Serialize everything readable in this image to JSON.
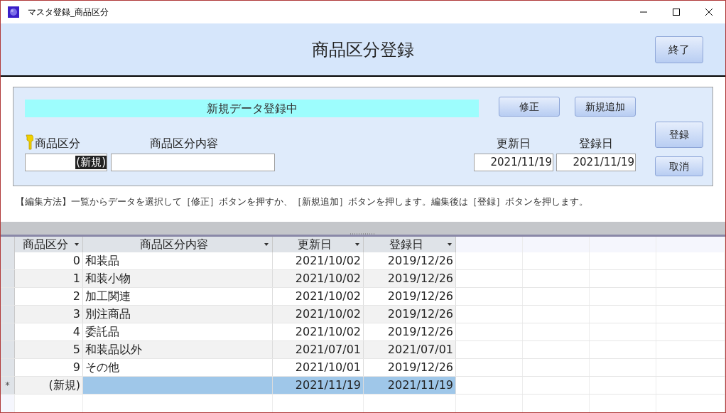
{
  "window": {
    "title": "マスタ登録_商品区分"
  },
  "header": {
    "title": "商品区分登録",
    "close_button": "終了"
  },
  "form": {
    "status": "新規データ登録中",
    "buttons": [
      {
        "label": "修正"
      },
      {
        "label": "新規追加"
      }
    ],
    "fields": [
      {
        "label": "商品区分",
        "key": true,
        "value": "(新規)",
        "selected_text": true
      },
      {
        "label": "商品区分内容"
      }
    ],
    "date_fields": [
      {
        "label": "更新日",
        "value": "2021/11/19"
      },
      {
        "label": "登録日",
        "value": "2021/11/19"
      }
    ],
    "side_buttons": [
      {
        "label": "登録"
      },
      {
        "label": "取消"
      }
    ]
  },
  "instructions": "【編集方法】一覧からデータを選択して［修正］ボタンを押すか、［新規追加］ボタンを押します。編集後は［登録］ボタンを押します。",
  "table": {
    "columns": [
      "商品区分",
      "商品区分内容",
      "更新日",
      "登録日"
    ],
    "rows": [
      {
        "kind": "data",
        "cells": [
          "0",
          "和装品",
          "2021/10/02",
          "2019/12/26"
        ],
        "selected": false
      },
      {
        "kind": "data",
        "cells": [
          "1",
          "和装小物",
          "2021/10/02",
          "2019/12/26"
        ],
        "selected": false
      },
      {
        "kind": "data",
        "cells": [
          "2",
          "加工関連",
          "2021/10/02",
          "2019/12/26"
        ],
        "selected": false
      },
      {
        "kind": "data",
        "cells": [
          "3",
          "別注商品",
          "2021/10/02",
          "2019/12/26"
        ],
        "selected": false
      },
      {
        "kind": "data",
        "cells": [
          "4",
          "委託品",
          "2021/10/02",
          "2019/12/26"
        ],
        "selected": false
      },
      {
        "kind": "data",
        "cells": [
          "5",
          "和装品以外",
          "2021/07/01",
          "2021/07/01"
        ],
        "selected": false
      },
      {
        "kind": "data",
        "cells": [
          "9",
          "その他",
          "2021/10/01",
          "2019/12/26"
        ],
        "selected": false
      },
      {
        "kind": "new",
        "marker": "*",
        "cells": [
          "(新規)",
          "",
          "2021/11/19",
          "2021/11/19"
        ],
        "selected": true
      }
    ]
  }
}
